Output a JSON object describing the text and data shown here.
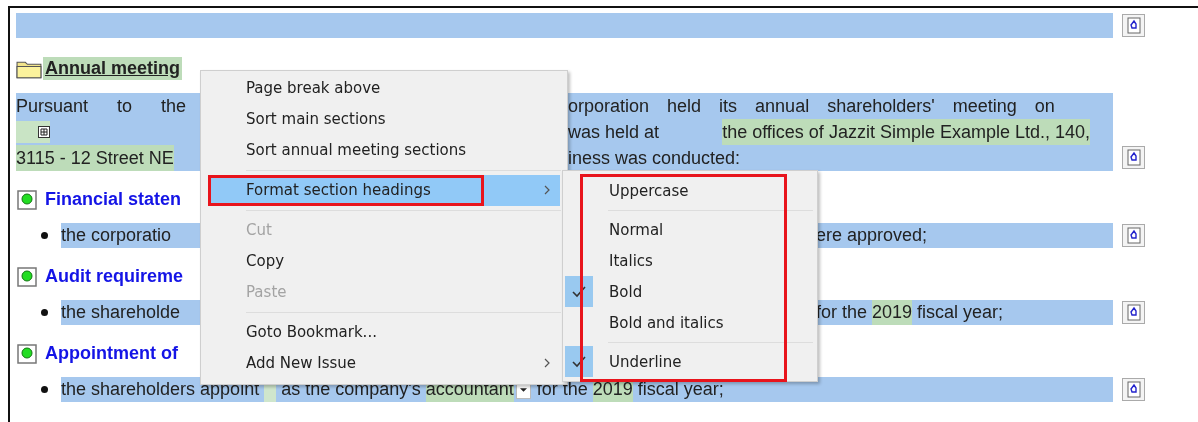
{
  "document": {
    "title": "Annual meeting",
    "paragraph": [
      {
        "left": [
          {
            "text": "Pursuant to the",
            "highlighted": false
          }
        ],
        "right": [
          {
            "text": "orporation held its annual shareholders' meeting on",
            "highlighted": false
          }
        ]
      },
      {
        "left": [
          {
            "kind": "marker",
            "highlighted": true
          }
        ],
        "right": [
          {
            "text": "was held at",
            "highlighted": false
          },
          {
            "text": "the offices of Jazzit Simple Example Ltd., 140,",
            "highlighted": true
          }
        ]
      },
      {
        "left": [
          {
            "text": "3115 - 12 Street NE",
            "highlighted": true
          }
        ],
        "right": [
          {
            "text": "iness was conducted:",
            "highlighted": false
          }
        ]
      }
    ],
    "sections": [
      {
        "heading": "Financial staten",
        "item": {
          "left": [
            {
              "text": "the corporatio",
              "highlighted": false
            }
          ],
          "right": [
            {
              "text": "ere approved;",
              "highlighted": false
            }
          ]
        }
      },
      {
        "heading": "Audit requireme",
        "item": {
          "left": [
            {
              "text": "the shareholde",
              "highlighted": false
            }
          ],
          "right": [
            {
              "text": "for the",
              "highlighted": false
            },
            {
              "text": "2019",
              "highlighted": true
            },
            {
              "text": "fiscal year;",
              "highlighted": false
            }
          ]
        }
      },
      {
        "heading": "Appointment of",
        "item": {
          "left": [
            {
              "text": "the shareholders appoint",
              "highlighted": false
            },
            {
              "kind": "blank",
              "highlighted": true
            },
            {
              "text": "as the company's",
              "highlighted": false
            },
            {
              "text": "accountant",
              "highlighted": true
            },
            {
              "kind": "dropdown"
            },
            {
              "text": "for the",
              "highlighted": false
            },
            {
              "text": "2019",
              "highlighted": true
            },
            {
              "text": "fiscal year;",
              "highlighted": false
            }
          ]
        }
      }
    ]
  },
  "context_menu": {
    "items": [
      {
        "kind": "item",
        "label": "Page break above",
        "disabled": false,
        "selected": false,
        "submenu": false,
        "annotated": false
      },
      {
        "kind": "item",
        "label": "Sort main sections",
        "disabled": false,
        "selected": false,
        "submenu": false,
        "annotated": false
      },
      {
        "kind": "item",
        "label": "Sort annual meeting sections",
        "disabled": false,
        "selected": false,
        "submenu": false,
        "annotated": false
      },
      {
        "kind": "separator"
      },
      {
        "kind": "item",
        "label": "Format section headings",
        "disabled": false,
        "selected": true,
        "submenu": true,
        "annotated": true
      },
      {
        "kind": "separator"
      },
      {
        "kind": "item",
        "label": "Cut",
        "disabled": true,
        "selected": false,
        "submenu": false,
        "annotated": false
      },
      {
        "kind": "item",
        "label": "Copy",
        "disabled": false,
        "selected": false,
        "submenu": false,
        "annotated": false
      },
      {
        "kind": "item",
        "label": "Paste",
        "disabled": true,
        "selected": false,
        "submenu": false,
        "annotated": false
      },
      {
        "kind": "separator"
      },
      {
        "kind": "item",
        "label": "Goto Bookmark...",
        "disabled": false,
        "selected": false,
        "submenu": false,
        "annotated": false
      },
      {
        "kind": "item",
        "label": "Add New Issue",
        "disabled": false,
        "selected": false,
        "submenu": true,
        "annotated": false
      }
    ]
  },
  "submenu": {
    "annotated": true,
    "items": [
      {
        "kind": "item",
        "label": "Uppercase",
        "checked": false
      },
      {
        "kind": "separator"
      },
      {
        "kind": "item",
        "label": "Normal",
        "checked": false
      },
      {
        "kind": "item",
        "label": "Italics",
        "checked": false
      },
      {
        "kind": "item",
        "label": "Bold",
        "checked": true
      },
      {
        "kind": "item",
        "label": "Bold and italics",
        "checked": false
      },
      {
        "kind": "separator"
      },
      {
        "kind": "item",
        "label": "Underline",
        "checked": true
      }
    ]
  }
}
